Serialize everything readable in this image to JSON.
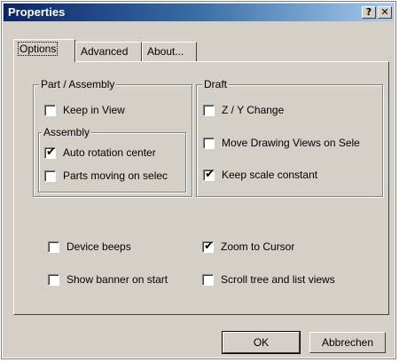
{
  "window": {
    "title": "Properties",
    "help_glyph": "?",
    "close_glyph": "✕"
  },
  "tabs": [
    {
      "label": "Options",
      "active": true
    },
    {
      "label": "Advanced",
      "active": false
    },
    {
      "label": "About...",
      "active": false
    }
  ],
  "part_assembly": {
    "title": "Part / Assembly",
    "keep_in_view": {
      "label": "Keep in View",
      "checked": false
    },
    "assembly": {
      "title": "Assembly",
      "auto_rotation": {
        "label": "Auto rotation center",
        "checked": true
      },
      "parts_moving": {
        "label": "Parts moving on selec",
        "checked": false
      }
    }
  },
  "draft": {
    "title": "Draft",
    "zy_change": {
      "label": "Z / Y Change",
      "checked": false
    },
    "move_views": {
      "label": "Move Drawing Views on Sele",
      "checked": false
    },
    "keep_scale": {
      "label": "Keep scale constant",
      "checked": true
    }
  },
  "general": {
    "device_beeps": {
      "label": "Device beeps",
      "checked": false
    },
    "zoom_cursor": {
      "label": "Zoom to Cursor",
      "checked": true
    },
    "show_banner": {
      "label": "Show banner on start",
      "checked": false
    },
    "scroll_tree": {
      "label": "Scroll tree and list views",
      "checked": false
    }
  },
  "buttons": {
    "ok": "OK",
    "cancel": "Abbrechen"
  },
  "check_glyph": "✔"
}
